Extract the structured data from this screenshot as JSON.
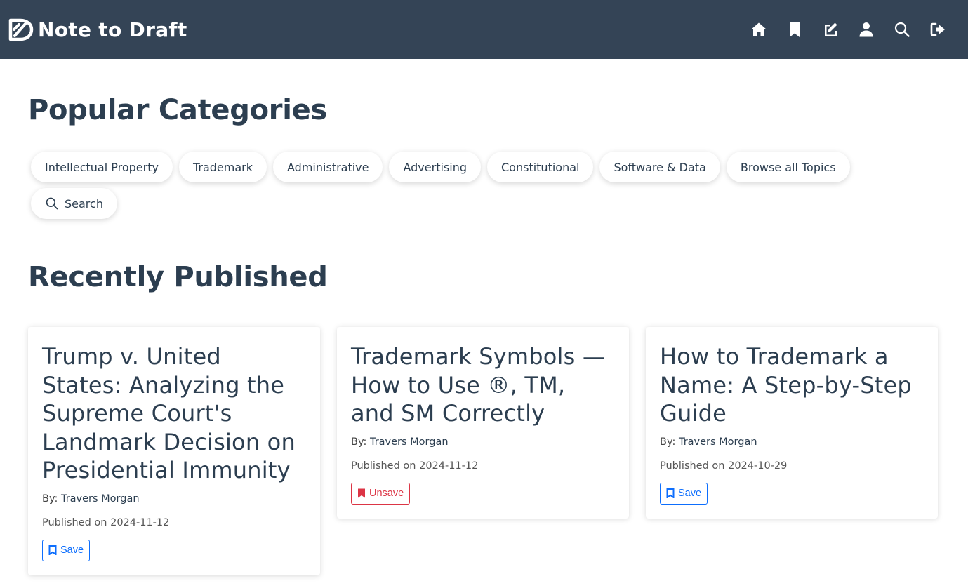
{
  "app": {
    "name": "Note to Draft"
  },
  "nav": {
    "icons": [
      "home-icon",
      "bookmark-icon",
      "edit-icon",
      "user-icon",
      "search-icon",
      "logout-icon"
    ]
  },
  "popular": {
    "title": "Popular Categories",
    "categories": [
      "Intellectual Property",
      "Trademark",
      "Administrative",
      "Advertising",
      "Constitutional",
      "Software & Data",
      "Browse all Topics"
    ],
    "search_label": "Search"
  },
  "recent": {
    "title": "Recently Published",
    "articles": [
      {
        "title": "Trump v. United States: Analyzing the Supreme Court's Landmark Decision on Presidential Immunity",
        "by_prefix": "By:",
        "author": "Travers Morgan",
        "date": "Published on 2024-11-12",
        "button": "Save",
        "saved": false
      },
      {
        "title": "Trademark Symbols — How to Use ®, TM, and SM Correctly",
        "by_prefix": "By:",
        "author": "Travers Morgan",
        "date": "Published on 2024-11-12",
        "button": "Unsave",
        "saved": true
      },
      {
        "title": "How to Trademark a Name: A Step-by-Step Guide",
        "by_prefix": "By:",
        "author": "Travers Morgan",
        "date": "Published on 2024-10-29",
        "button": "Save",
        "saved": false
      }
    ]
  },
  "colors": {
    "navbar": "#344456",
    "text": "#2c3e50",
    "save": "#0d6efd",
    "unsave": "#dc3545"
  }
}
